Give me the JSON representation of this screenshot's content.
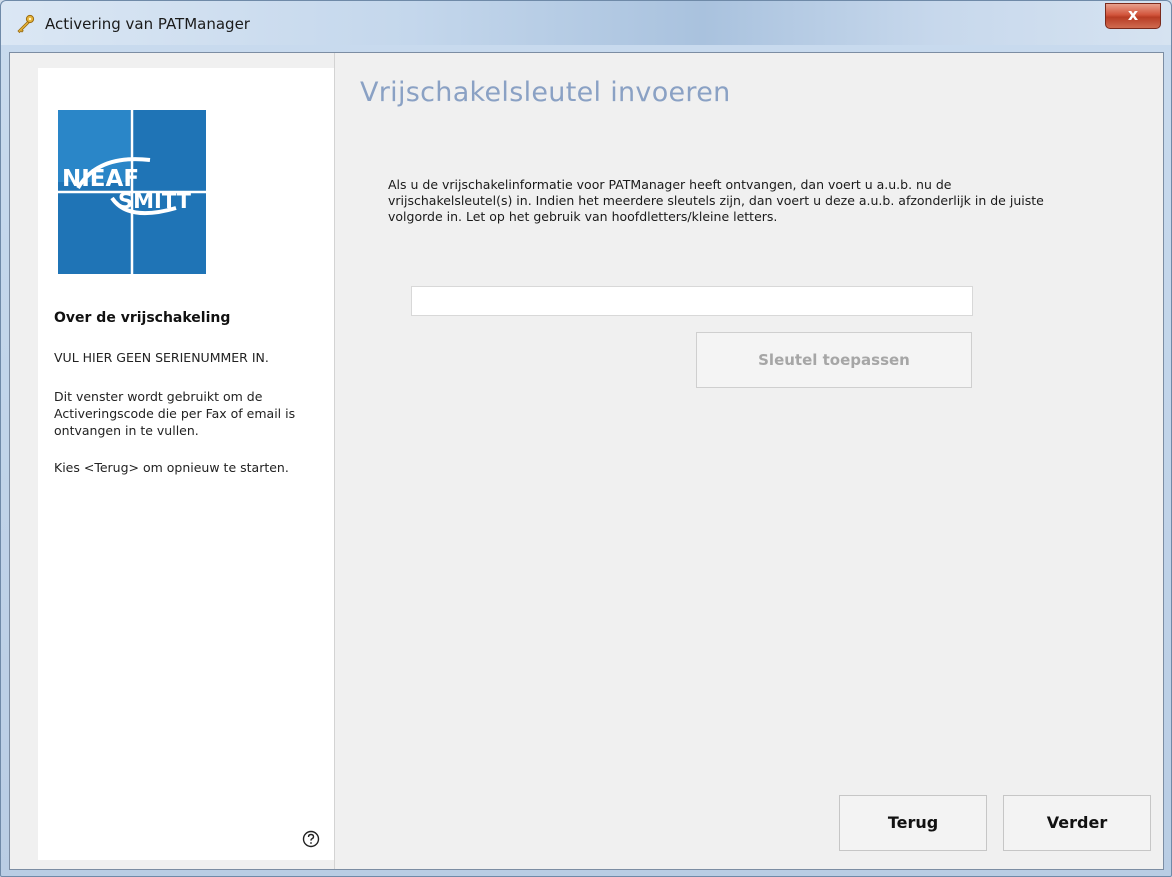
{
  "window": {
    "title": "Activering van PATManager",
    "close_label": "x"
  },
  "sidebar": {
    "logo": {
      "line1": "NIEAF",
      "line2": "SMITT",
      "color": "#1f74b6"
    },
    "about_title": "Over de vrijschakeling",
    "paragraphs": [
      "VUL HIER GEEN SERIENUMMER IN.",
      "Dit venster wordt gebruikt om de Activeringscode die per Fax of email is ontvangen in te vullen.",
      "Kies <Terug> om opnieuw te starten."
    ],
    "help_icon": "help-icon"
  },
  "main": {
    "heading": "Vrijschakelsleutel invoeren",
    "instructions": "Als u de vrijschakelinformatie voor PATManager heeft ontvangen, dan voert u a.u.b. nu de vrijschakelsleutel(s) in. Indien het meerdere sleutels zijn, dan voert u deze a.u.b. afzonderlijk in de juiste volgorde in. Let op het gebruik van hoofdletters/kleine letters.",
    "key_input": {
      "value": "",
      "placeholder": ""
    },
    "apply_label": "Sleutel toepassen"
  },
  "footer": {
    "back_label": "Terug",
    "next_label": "Verder"
  },
  "colors": {
    "heading": "#8aa1c4",
    "logo_blue": "#1f74b6",
    "client_bg": "#f0f0f0"
  }
}
